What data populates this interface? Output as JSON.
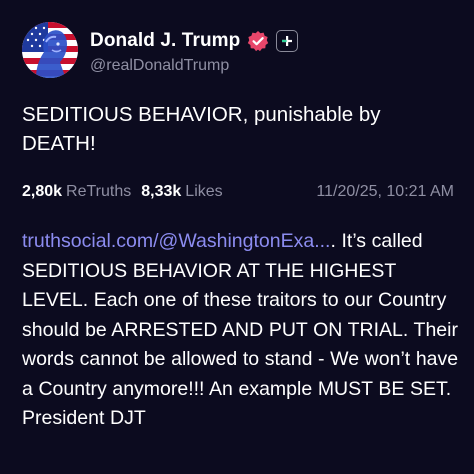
{
  "author": {
    "display_name": "Donald J. Trump",
    "handle": "@realDonaldTrump",
    "avatar_icon": "flag-portrait-avatar",
    "verified_icon": "verified-badge-icon",
    "verified_color": "#e8466a",
    "follow_icon": "plus-icon",
    "follow_color": "#2fd39a"
  },
  "post": {
    "headline": "SEDITIOUS BEHAVIOR, punishable by DEATH!",
    "retruths_count": "2,80k",
    "retruths_label": "ReTruths",
    "likes_count": "8,33k",
    "likes_label": "Likes",
    "timestamp": "11/20/25, 10:21 AM",
    "link_text": "truthsocial.com/@WashingtonExa...",
    "body_rest": ". It’s called SEDITIOUS BEHAVIOR AT THE HIGHEST LEVEL. Each one of these traitors to our Country should be ARRESTED AND PUT ON TRIAL. Their words cannot be allowed to stand - We won’t have a Country anymore!!! An example MUST BE SET. President DJT"
  },
  "colors": {
    "background": "#0c0b1f",
    "link": "#8c8cf0",
    "muted": "#8f8fa3"
  }
}
